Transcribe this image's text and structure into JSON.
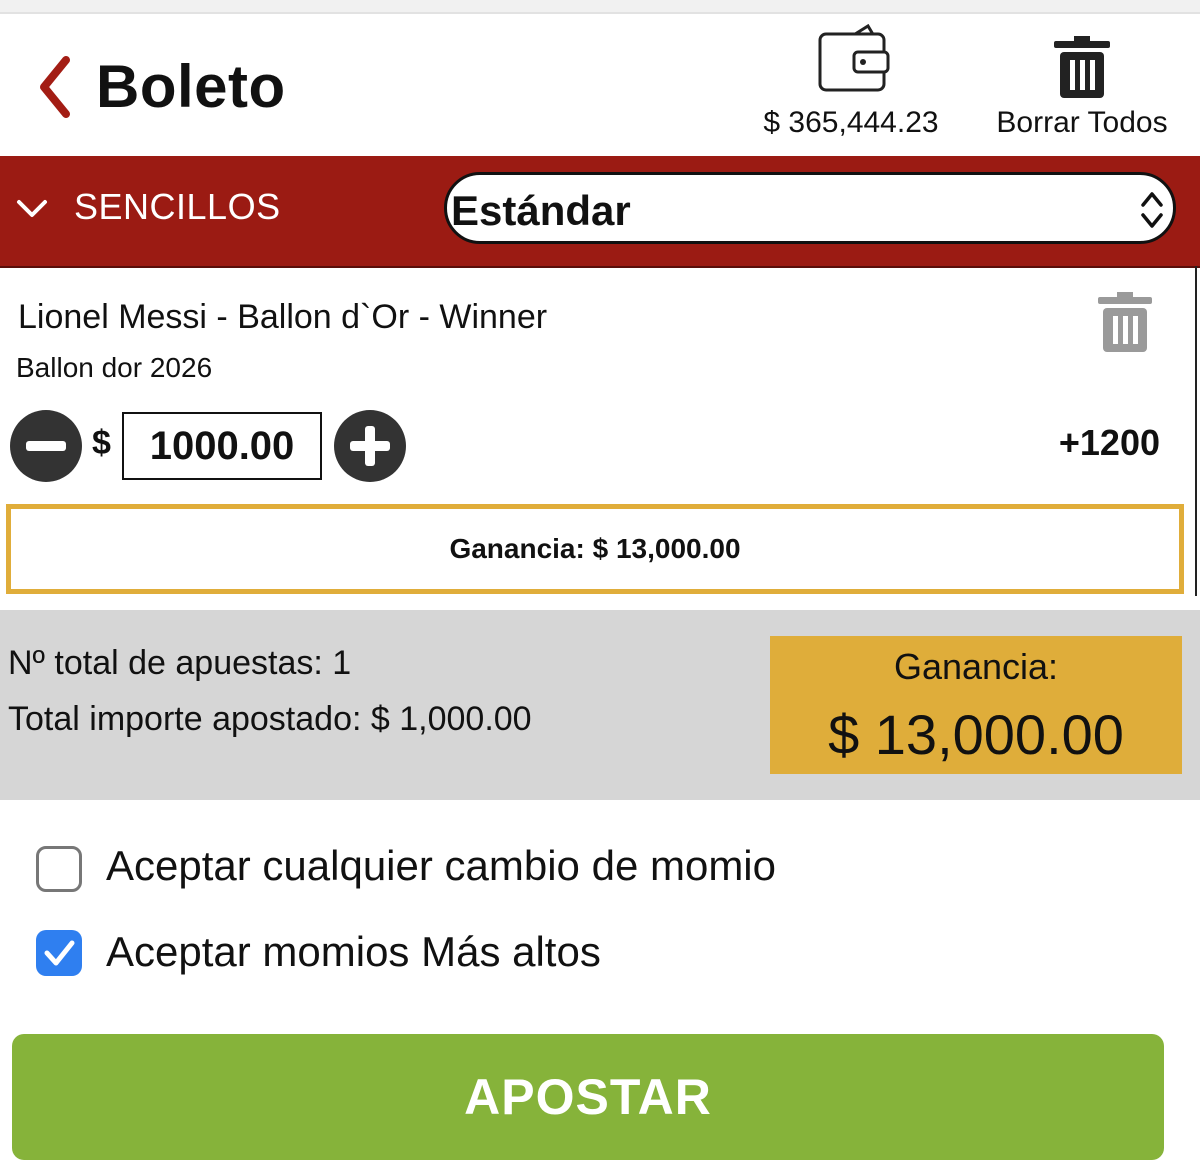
{
  "header": {
    "title": "Boleto",
    "balance": "$ 365,444.23",
    "clear_all_label": "Borrar Todos",
    "icons": [
      "chevron-left-icon",
      "wallet-icon",
      "trash-icon"
    ]
  },
  "section_bar": {
    "label": "SENCILLOS",
    "bet_type_selected": "Estándar"
  },
  "bet": {
    "selection": "Lionel Messi - Ballon d`Or - Winner",
    "event": "Ballon dor 2026",
    "currency": "$",
    "stake": "1000.00",
    "odds": "+1200",
    "profit": "Ganancia: $ 13,000.00"
  },
  "summary": {
    "total_bets": "Nº total de apuestas: 1",
    "total_stake": "Total importe apostado: $ 1,000.00",
    "gain_label": "Ganancia:",
    "gain_amount": "$ 13,000.00"
  },
  "options": [
    {
      "label": "Aceptar cualquier cambio de momio",
      "checked": false
    },
    {
      "label": "Aceptar momios Más altos",
      "checked": true
    }
  ],
  "submit_label": "APOSTAR",
  "colors": {
    "brand_red": "#9b1b13",
    "gold": "#dfad3a",
    "submit_green": "#86b33a",
    "checkbox_blue": "#2f7ff0"
  }
}
